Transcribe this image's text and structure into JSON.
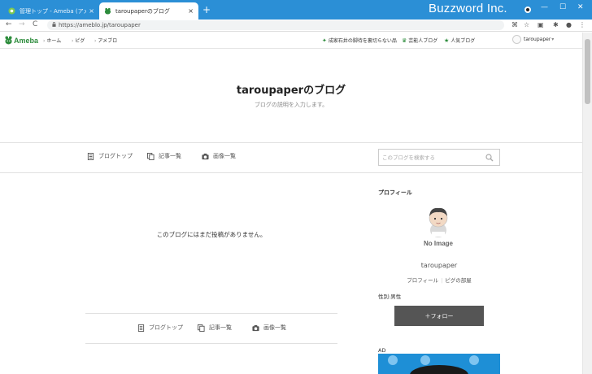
{
  "browser": {
    "tabs": [
      {
        "label": "管理トップ - Ameba (アメーバ)",
        "active": false
      },
      {
        "label": "taroupaperのブログ",
        "active": true
      }
    ],
    "new_tab": "+",
    "close_glyph": "×",
    "window_title_overlay": "Buzzword Inc.",
    "controls": {
      "minimize": "—",
      "maximize": "☐",
      "close": "✕"
    },
    "nav": {
      "back": "←",
      "forward": "→",
      "reload": "C"
    },
    "url": "https://ameblo.jp/taroupaper"
  },
  "ameba_header": {
    "logo_text": "Ameba",
    "nav": [
      "ホーム",
      "ピグ",
      "アメブロ"
    ],
    "right_links": [
      "成家石井の脚待を裏切らない品",
      "芸能人ブログ",
      "人気ブログ"
    ],
    "user": "taroupaper",
    "user_caret": "▾"
  },
  "blog": {
    "title": "taroupaperのブログ",
    "description": "ブログの説明を入力します。",
    "nav": [
      "ブログトップ",
      "記事一覧",
      "画像一覧"
    ],
    "search_placeholder": "このブログを検索する",
    "empty_message": "このブログにはまだ投稿がありません。"
  },
  "sidebar": {
    "profile_heading": "プロフィール",
    "no_image_text": "No Image",
    "profile_name": "taroupaper",
    "profile_links": [
      "プロフィール",
      "ピグの部屋"
    ],
    "link_separator": "|",
    "gender": "性別:男性",
    "follow_label": "＋フォロー",
    "ad_label": "AD"
  },
  "colors": {
    "chrome_blue": "#2b8fd6",
    "ameba_green": "#2d8c3c",
    "follow_button": "#555555"
  }
}
